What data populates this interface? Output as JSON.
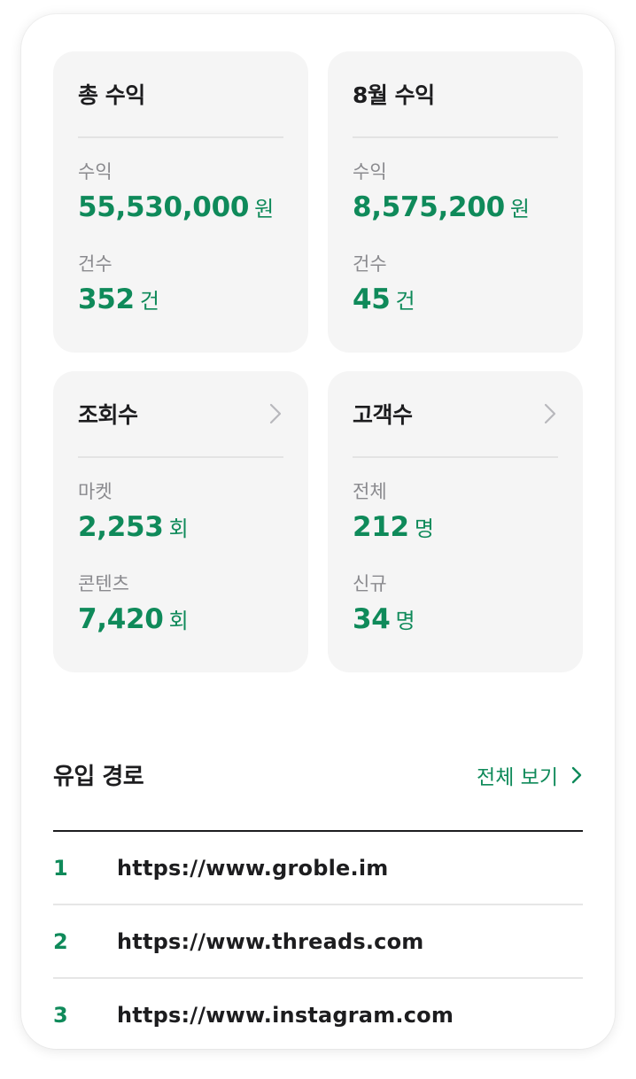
{
  "colors": {
    "accent": "#0f8a5a",
    "card_bg": "#f5f5f5",
    "text": "#1d1d1f",
    "muted": "#8a8a8e"
  },
  "cards": [
    {
      "title": "총 수익",
      "rows": [
        {
          "label": "수익",
          "value": "55,530,000",
          "unit": "원"
        },
        {
          "label": "건수",
          "value": "352",
          "unit": "건"
        }
      ]
    },
    {
      "title": "8월 수익",
      "rows": [
        {
          "label": "수익",
          "value": "8,575,200",
          "unit": "원"
        },
        {
          "label": "건수",
          "value": "45",
          "unit": "건"
        }
      ]
    },
    {
      "title": "조회수",
      "icon": "chevron-right-icon",
      "rows": [
        {
          "label": "마켓",
          "value": "2,253",
          "unit": "회"
        },
        {
          "label": "콘텐츠",
          "value": "7,420",
          "unit": "회"
        }
      ]
    },
    {
      "title": "고객수",
      "icon": "chevron-right-icon",
      "rows": [
        {
          "label": "전체",
          "value": "212",
          "unit": "명"
        },
        {
          "label": "신규",
          "value": "34",
          "unit": "명"
        }
      ]
    }
  ],
  "referrers": {
    "title": "유입 경로",
    "view_all_label": "전체 보기",
    "items": [
      {
        "rank": "1",
        "url": "https://www.groble.im"
      },
      {
        "rank": "2",
        "url": "https://www.threads.com"
      },
      {
        "rank": "3",
        "url": "https://www.instagram.com"
      }
    ]
  }
}
